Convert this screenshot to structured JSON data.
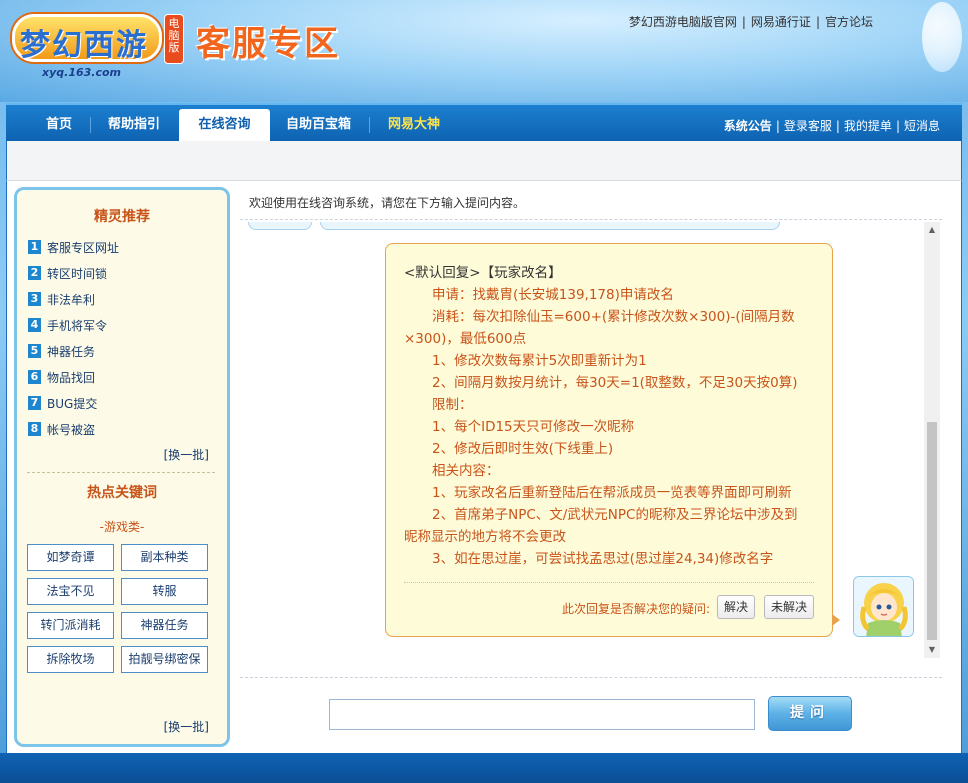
{
  "header": {
    "logo_text": "梦幻西游",
    "logo_badge": "电脑版",
    "logo_url": "xyq.163.com",
    "site_title": "客服专区",
    "top_links": [
      "梦幻西游电脑版官网",
      "网易通行证",
      "官方论坛"
    ]
  },
  "nav": {
    "items": [
      "首页",
      "帮助指引",
      "在线咨询",
      "自助百宝箱",
      "网易大神"
    ],
    "active": "在线咨询",
    "right_links": [
      "系统公告",
      "登录客服",
      "我的提单",
      "短消息"
    ]
  },
  "sidebar": {
    "title": "精灵推荐",
    "items": [
      {
        "num": "1",
        "label": "客服专区网址"
      },
      {
        "num": "2",
        "label": "转区时间锁"
      },
      {
        "num": "3",
        "label": "非法牟利"
      },
      {
        "num": "4",
        "label": "手机将军令"
      },
      {
        "num": "5",
        "label": "神器任务"
      },
      {
        "num": "6",
        "label": "物品找回"
      },
      {
        "num": "7",
        "label": "BUG提交"
      },
      {
        "num": "8",
        "label": "帐号被盗"
      }
    ],
    "refresh_label": "[换一批]",
    "hot_title": "热点关键词",
    "category": "-游戏类-",
    "keywords": [
      "如梦奇谭",
      "副本种类",
      "法宝不见",
      "转服",
      "转门派消耗",
      "神器任务",
      "拆除牧场",
      "拍靓号绑密保"
    ],
    "refresh_label_2": "[换一批]"
  },
  "main": {
    "welcome": "欢迎使用在线咨询系统，请您在下方输入提问内容。",
    "reply": {
      "heading": "<默认回复>【玩家改名】",
      "lines": [
        "申请：找戴胄(长安城139,178)申请改名",
        "消耗：每次扣除仙玉=600+(累计修改次数×300)-(间隔月数",
        "×300)，最低600点",
        "1、修改次数每累计5次即重新计为1",
        "2、间隔月数按月统计，每30天=1(取整数，不足30天按0算)",
        "限制：",
        "1、每个ID15天只可修改一次昵称",
        "2、修改后即时生效(下线重上)",
        "相关内容：",
        "1、玩家改名后重新登陆后在帮派成员一览表等界面即可刷新",
        "2、首席弟子NPC、文/武状元NPC的昵称及三界论坛中涉及到",
        "昵称显示的地方将不会更改",
        "3、如在思过崖，可尝试找孟思过(思过崖24,34)修改名字"
      ],
      "question": "此次回复是否解决您的疑问:",
      "solved_label": "解决",
      "unsolved_label": "未解决"
    },
    "input_value": "",
    "ask_label": "提问"
  },
  "colors": {
    "nav_blue": "#0e63b2",
    "reply_text": "#c8541a",
    "bubble_bg": "#fefbd8",
    "sidebar_title": "#c8541a"
  }
}
